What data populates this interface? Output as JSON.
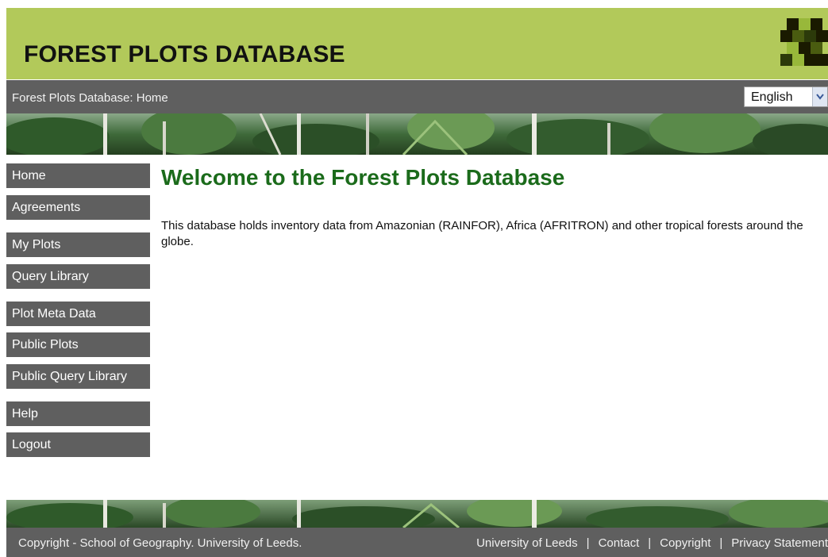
{
  "header": {
    "site_title": "FOREST PLOTS DATABASE",
    "brand_color": "#b2c95a",
    "logo_colors": [
      "#1a1a00",
      "#4a5c10",
      "#98b83a",
      "#2c3a0a"
    ]
  },
  "breadcrumb_bar": {
    "breadcrumb": "Forest Plots Database: Home",
    "language_select": {
      "selected": "English",
      "icon": "chevron-down-icon"
    }
  },
  "sidebar": {
    "items": [
      {
        "label": "Home"
      },
      {
        "label": "Agreements"
      },
      {
        "label": "My Plots"
      },
      {
        "label": "Query Library"
      },
      {
        "label": "Plot Meta Data"
      },
      {
        "label": "Public Plots"
      },
      {
        "label": "Public Query Library"
      },
      {
        "label": "Help"
      },
      {
        "label": "Logout"
      }
    ]
  },
  "main": {
    "title": "Welcome to the Forest Plots Database",
    "title_color": "#1b6b1b",
    "intro": "This database holds inventory data from Amazonian (RAINFOR), Africa (AFRITRON) and other tropical forests around the globe."
  },
  "footer": {
    "copyright": "Copyright - School of Geography. University of Leeds.",
    "links": [
      {
        "label": "University of Leeds"
      },
      {
        "label": "Contact"
      },
      {
        "label": "Copyright"
      },
      {
        "label": "Privacy Statement"
      }
    ]
  }
}
